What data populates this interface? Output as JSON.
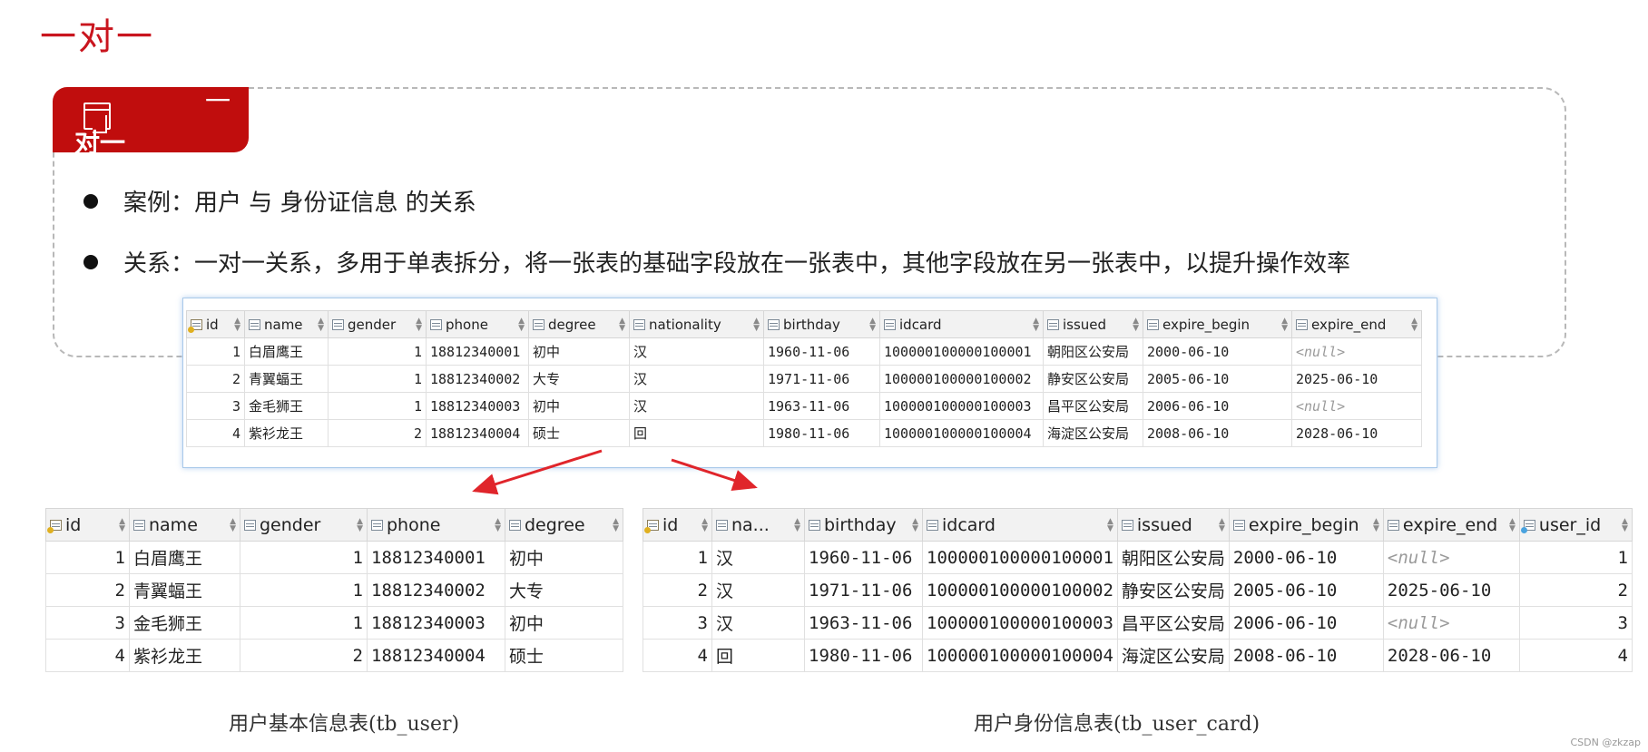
{
  "page_title": "一对一",
  "tag": {
    "line1": "一",
    "line2": "对一",
    "icon": "window-icon"
  },
  "bullets": [
    "案例：用户  与  身份证信息  的关系",
    "关系：一对一关系，多用于单表拆分，将一张表的基础字段放在一张表中，其他字段放在另一张表中，以提升操作效率"
  ],
  "main_table": {
    "columns": [
      "id",
      "name",
      "gender",
      "phone",
      "degree",
      "nationality",
      "birthday",
      "idcard",
      "issued",
      "expire_begin",
      "expire_end"
    ],
    "rows": [
      [
        "1",
        "白眉鹰王",
        "1",
        "18812340001",
        "初中",
        "汉",
        "1960-11-06",
        "100000100000100001",
        "朝阳区公安局",
        "2000-06-10",
        "<null>"
      ],
      [
        "2",
        "青翼蝠王",
        "1",
        "18812340002",
        "大专",
        "汉",
        "1971-11-06",
        "100000100000100002",
        "静安区公安局",
        "2005-06-10",
        "2025-06-10"
      ],
      [
        "3",
        "金毛狮王",
        "1",
        "18812340003",
        "初中",
        "汉",
        "1963-11-06",
        "100000100000100003",
        "昌平区公安局",
        "2006-06-10",
        "<null>"
      ],
      [
        "4",
        "紫衫龙王",
        "2",
        "18812340004",
        "硕士",
        "回",
        "1980-11-06",
        "100000100000100004",
        "海淀区公安局",
        "2008-06-10",
        "2028-06-10"
      ]
    ]
  },
  "user_table": {
    "columns": [
      "id",
      "name",
      "gender",
      "phone",
      "degree"
    ],
    "rows": [
      [
        "1",
        "白眉鹰王",
        "1",
        "18812340001",
        "初中"
      ],
      [
        "2",
        "青翼蝠王",
        "1",
        "18812340002",
        "大专"
      ],
      [
        "3",
        "金毛狮王",
        "1",
        "18812340003",
        "初中"
      ],
      [
        "4",
        "紫衫龙王",
        "2",
        "18812340004",
        "硕士"
      ]
    ],
    "caption": "用户基本信息表(tb_user)"
  },
  "card_table": {
    "columns": [
      "id",
      "na...",
      "birthday",
      "idcard",
      "issued",
      "expire_begin",
      "expire_end",
      "user_id"
    ],
    "rows": [
      [
        "1",
        "汉",
        "1960-11-06",
        "100000100000100001",
        "朝阳区公安局",
        "2000-06-10",
        "<null>",
        "1"
      ],
      [
        "2",
        "汉",
        "1971-11-06",
        "100000100000100002",
        "静安区公安局",
        "2005-06-10",
        "2025-06-10",
        "2"
      ],
      [
        "3",
        "汉",
        "1963-11-06",
        "100000100000100003",
        "昌平区公安局",
        "2006-06-10",
        "<null>",
        "3"
      ],
      [
        "4",
        "回",
        "1980-11-06",
        "100000100000100004",
        "海淀区公安局",
        "2008-06-10",
        "2028-06-10",
        "4"
      ]
    ],
    "caption": "用户身份信息表(tb_user_card)"
  },
  "watermark": "CSDN @zkzap",
  "colors": {
    "title_red": "#c9151e",
    "tag_red": "#c00d0d",
    "arrow_red": "#e0252b",
    "null_gray": "#9a9a9a"
  }
}
